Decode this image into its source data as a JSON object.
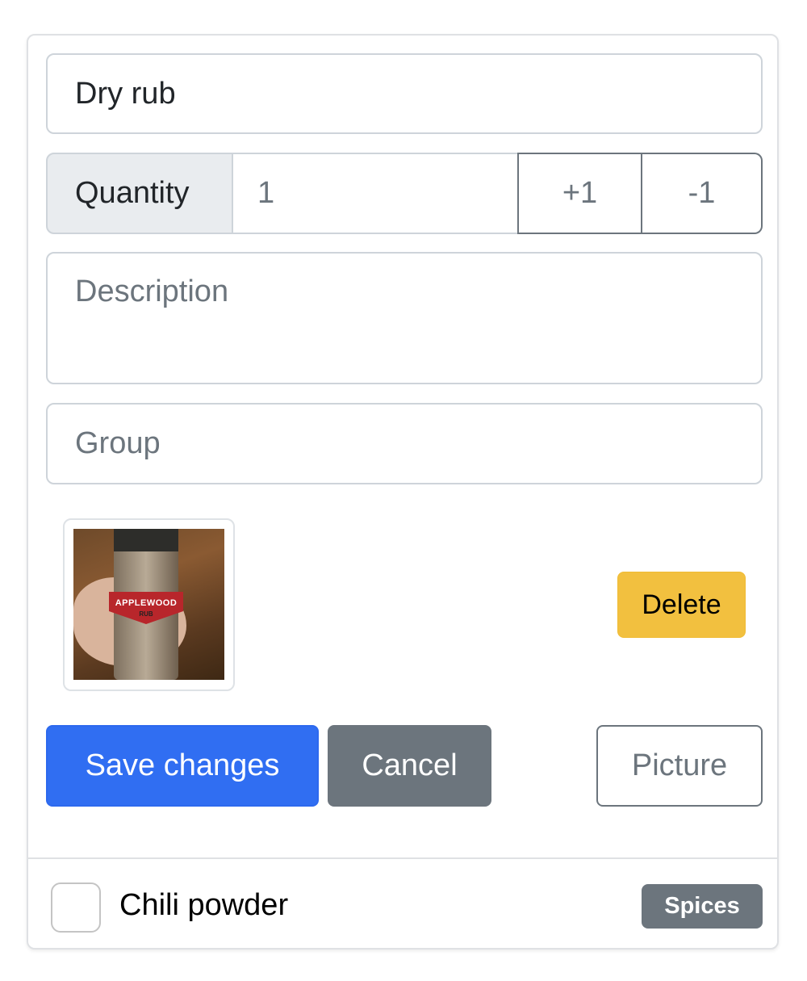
{
  "form": {
    "name_value": "Dry rub",
    "quantity": {
      "label": "Quantity",
      "value": "1",
      "increment_label": "+1",
      "decrement_label": "-1"
    },
    "description_placeholder": "Description",
    "group_placeholder": "Group"
  },
  "picture": {
    "alt": "Photo of Grill Mates Applewood Rub jar held in hand",
    "label_text": "APPLEWOOD",
    "sub_text": "RUB",
    "delete_label": "Delete"
  },
  "actions": {
    "save_label": "Save changes",
    "cancel_label": "Cancel",
    "picture_label": "Picture"
  },
  "list": {
    "items": [
      {
        "label": "Chili powder",
        "checked": false,
        "badge": "Spices"
      }
    ]
  },
  "colors": {
    "primary": "#306ef2",
    "secondary": "#6c757d",
    "warning": "#f2c03f"
  }
}
